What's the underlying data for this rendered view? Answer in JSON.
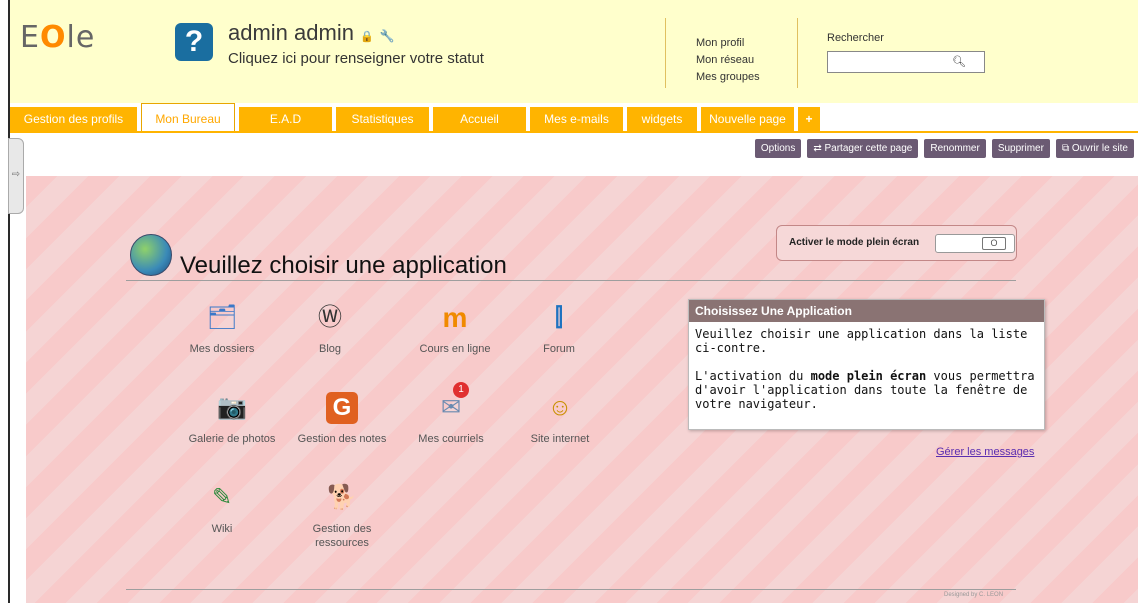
{
  "header": {
    "logo_prefix": "E",
    "logo_o": "O",
    "logo_suffix": "le",
    "user_name": "admin admin",
    "lock_glyph": "🔒",
    "key_glyph": "🔧",
    "status_prompt": "Cliquez ici pour renseigner votre statut",
    "links": [
      "Mon profil",
      "Mon réseau",
      "Mes groupes"
    ],
    "search_label": "Rechercher",
    "search_value": ""
  },
  "tabs": [
    {
      "label": "Gestion des profils",
      "active": false
    },
    {
      "label": "Mon Bureau",
      "active": true
    },
    {
      "label": "E.A.D",
      "active": false
    },
    {
      "label": "Statistiques",
      "active": false
    },
    {
      "label": "Accueil",
      "active": false
    },
    {
      "label": "Mes e-mails",
      "active": false
    },
    {
      "label": "widgets",
      "active": false
    },
    {
      "label": "Nouvelle page",
      "active": false
    },
    {
      "label": "+",
      "active": false
    }
  ],
  "actions": [
    "Options",
    "Partager cette page",
    "Renommer",
    "Supprimer",
    "Ouvrir le site"
  ],
  "main": {
    "title": "Veuillez choisir une application",
    "fullscreen_label": "Activer le mode plein écran",
    "toggle_state": "O",
    "apps": [
      {
        "label": "Mes dossiers",
        "icon": "folder-icon",
        "glyph": "🗂"
      },
      {
        "label": "Blog",
        "icon": "wordpress-icon",
        "glyph": "Ⓦ"
      },
      {
        "label": "Cours en ligne",
        "icon": "moodle-icon",
        "glyph": "m"
      },
      {
        "label": "Forum",
        "icon": "forum-icon",
        "glyph": "⫿"
      },
      {
        "label": "Galerie de photos",
        "icon": "camera-icon",
        "glyph": "📷"
      },
      {
        "label": "Gestion des notes",
        "icon": "grades-icon",
        "glyph": "G"
      },
      {
        "label": "Mes courriels",
        "icon": "mail-icon",
        "glyph": "✉"
      },
      {
        "label": "Site internet",
        "icon": "website-icon",
        "glyph": "☺"
      },
      {
        "label": "Wiki",
        "icon": "wiki-icon",
        "glyph": "✎"
      },
      {
        "label": "Gestion des ressources",
        "icon": "resources-icon",
        "glyph": "🐕"
      }
    ],
    "mail_badge": "1",
    "info": {
      "title": "Choisissez Une Application",
      "line1": "Veuillez choisir une application dans la liste ci-contre.",
      "line2_pre": "L'activation du ",
      "line2_bold": "mode plein écran",
      "line2_post": " vous permettra d'avoir l'application dans toute la fenêtre de votre navigateur."
    },
    "manage_link": "Gérer les messages",
    "credit": "Designed by C. LEON"
  },
  "colors": {
    "tab": "#ffb400",
    "header_bg": "#ffffcc",
    "action_btn": "#6b5a73",
    "info_head": "#8a7373"
  }
}
